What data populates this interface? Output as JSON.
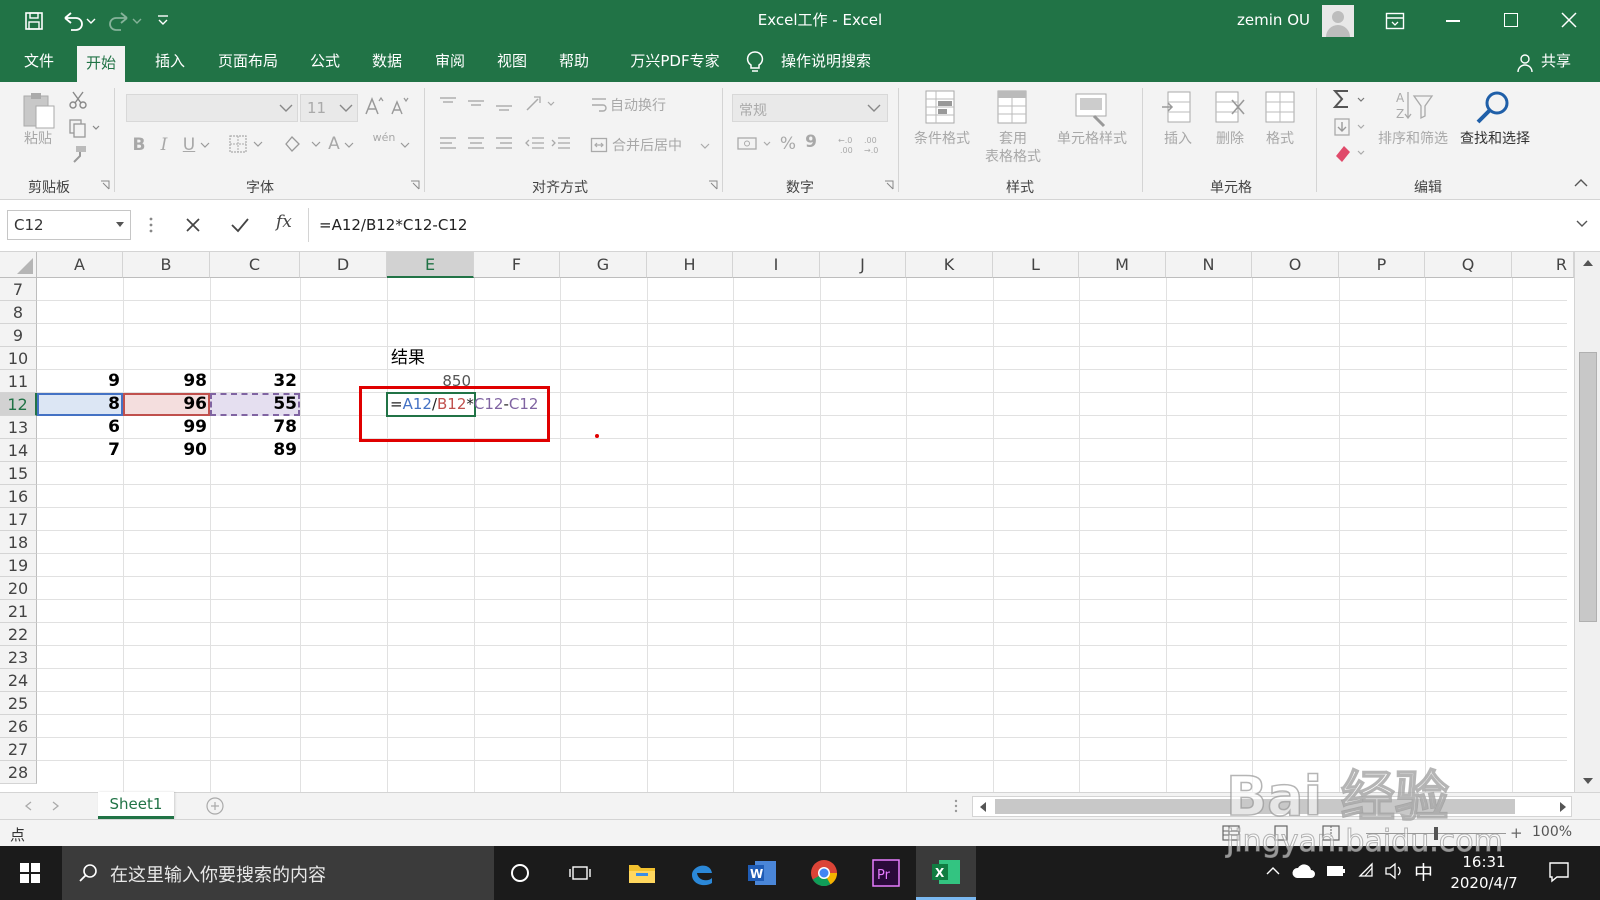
{
  "titlebar": {
    "title": "Excel工作 - Excel",
    "user": "zemin OU"
  },
  "tabs": [
    "文件",
    "开始",
    "插入",
    "页面布局",
    "公式",
    "数据",
    "审阅",
    "视图",
    "帮助",
    "万兴PDF专家"
  ],
  "tell_me": "操作说明搜索",
  "share": "共享",
  "ribbon": {
    "clipboard": {
      "paste": "粘贴",
      "label": "剪贴板"
    },
    "font": {
      "size": "11",
      "bold": "B",
      "italic": "I",
      "underline": "U",
      "font_color": "A",
      "wen": "wén",
      "label": "字体"
    },
    "alignment": {
      "wrap": "自动换行",
      "merge": "合并后居中",
      "label": "对齐方式"
    },
    "number": {
      "format": "常规",
      "percent": "%",
      "comma": "9",
      "label": "数字"
    },
    "styles": {
      "conditional": "条件格式",
      "table_line1": "套用",
      "table_line2": "表格格式",
      "cell_styles": "单元格样式",
      "label": "样式"
    },
    "cells": {
      "insert": "插入",
      "delete": "删除",
      "format": "格式",
      "label": "单元格"
    },
    "editing": {
      "sort": "排序和筛选",
      "find": "查找和选择",
      "label": "编辑"
    }
  },
  "formula_bar": {
    "name_box": "C12",
    "formula": "=A12/B12*C12-C12",
    "fx": "fx"
  },
  "columns": [
    "A",
    "B",
    "C",
    "D",
    "E",
    "F",
    "G",
    "H",
    "I",
    "J",
    "K",
    "L",
    "M",
    "N",
    "O",
    "P",
    "Q",
    "R"
  ],
  "rows": [
    "7",
    "8",
    "9",
    "10",
    "11",
    "12",
    "13",
    "14",
    "15",
    "16",
    "17",
    "18",
    "19",
    "20",
    "21",
    "22",
    "23",
    "24",
    "25",
    "26",
    "27",
    "28"
  ],
  "cells": {
    "E10": "结果",
    "A11": "9",
    "B11": "98",
    "C11": "32",
    "E11": "850",
    "A12": "8",
    "B12": "96",
    "C12": "55",
    "A13": "6",
    "B13": "99",
    "C13": "78",
    "A14": "7",
    "B14": "90",
    "C14": "89"
  },
  "editing_cell": {
    "eq": "=",
    "ref1": "A12",
    "op1": "/",
    "ref2": "B12",
    "op2": "*",
    "ref3": "C12",
    "op3": "-",
    "ref4": "C12"
  },
  "sheet": {
    "name": "Sheet1"
  },
  "status": {
    "mode": "点",
    "zoom": "100%"
  },
  "taskbar": {
    "search_placeholder": "在这里输入你要搜索的内容",
    "ime": "中",
    "time": "16:31",
    "date": "2020/4/7"
  },
  "watermark": {
    "line1": "Bai 经验",
    "line2": "jingyan.baidu.com"
  },
  "colors": {
    "excel_green": "#217346",
    "ref_blue": "#4472c4",
    "ref_red": "#c0504d",
    "ref_purple": "#8064a2",
    "highlight_red": "#e00000"
  }
}
